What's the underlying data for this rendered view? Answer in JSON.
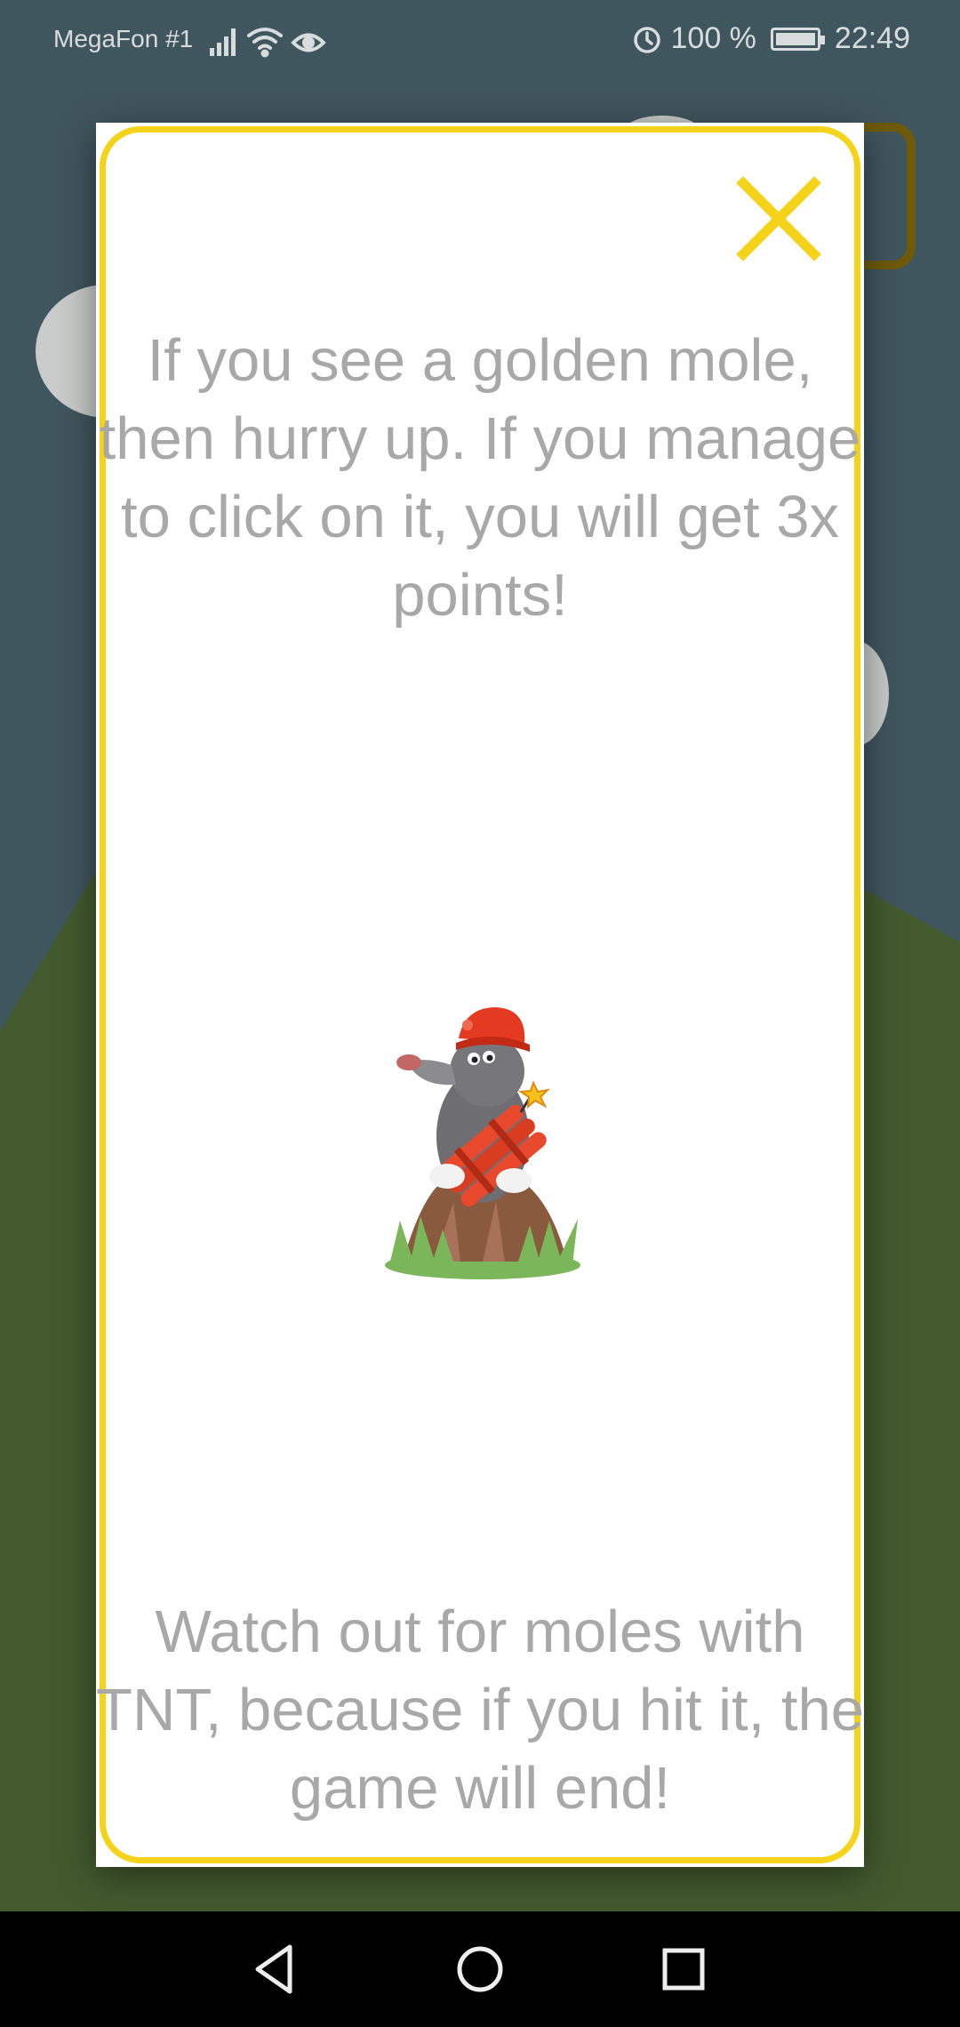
{
  "status_bar": {
    "carrier": "MegaFon #1",
    "battery_level": "100 %",
    "time": "22:49",
    "icons": [
      "signal-icon",
      "wifi-icon",
      "eye-icon",
      "alarm-icon",
      "battery-icon"
    ]
  },
  "dialog": {
    "close_icon": "close-icon",
    "tip_golden": "If you see a golden mole, then hurry up. If you manage to click on it, you will get 3x points!",
    "tip_tnt": "Watch out for moles with TNT, because if you hit it, the game will end!",
    "illustration": "mole-with-tnt-icon"
  },
  "nav_bar": {
    "buttons": [
      "back-icon",
      "home-icon",
      "recents-icon"
    ]
  },
  "colors": {
    "accent": "#F4D31A",
    "text_muted": "#A8A8A8",
    "sky": "#40565E",
    "grass": "#435A2E"
  }
}
